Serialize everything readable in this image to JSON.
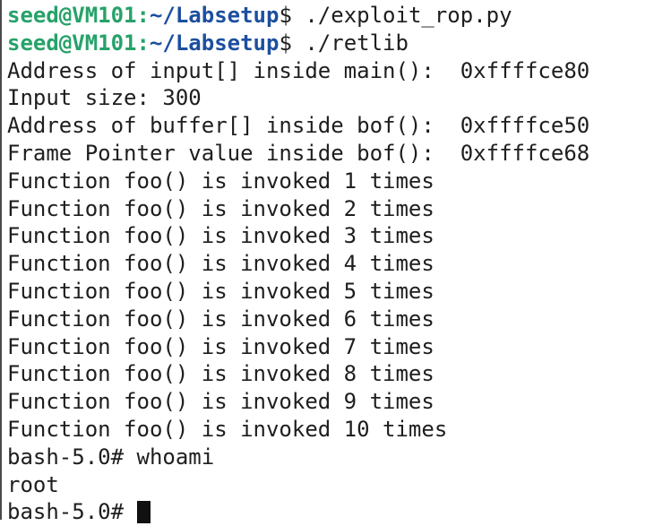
{
  "terminal": {
    "prompt_user": "seed@VM101",
    "prompt_colon": ":",
    "prompt_path": "~/Labsetup",
    "prompt_symbol": "$ ",
    "commands": [
      "./exploit_rop.py",
      "./retlib"
    ],
    "output": [
      "Address of input[] inside main():  0xffffce80",
      "Input size: 300",
      "Address of buffer[] inside bof():  0xffffce50",
      "Frame Pointer value inside bof():  0xffffce68",
      "Function foo() is invoked 1 times",
      "Function foo() is invoked 2 times",
      "Function foo() is invoked 3 times",
      "Function foo() is invoked 4 times",
      "Function foo() is invoked 5 times",
      "Function foo() is invoked 6 times",
      "Function foo() is invoked 7 times",
      "Function foo() is invoked 8 times",
      "Function foo() is invoked 9 times",
      "Function foo() is invoked 10 times"
    ],
    "root_prompt": "bash-5.0# ",
    "root_command": "whoami",
    "root_output": "root",
    "root_prompt_final": "bash-5.0# "
  },
  "colors": {
    "prompt_user": "#26a269",
    "prompt_path": "#1c4f9f",
    "text": "#1e1e1e",
    "background": "#ffffff",
    "cursor": "#111111"
  }
}
